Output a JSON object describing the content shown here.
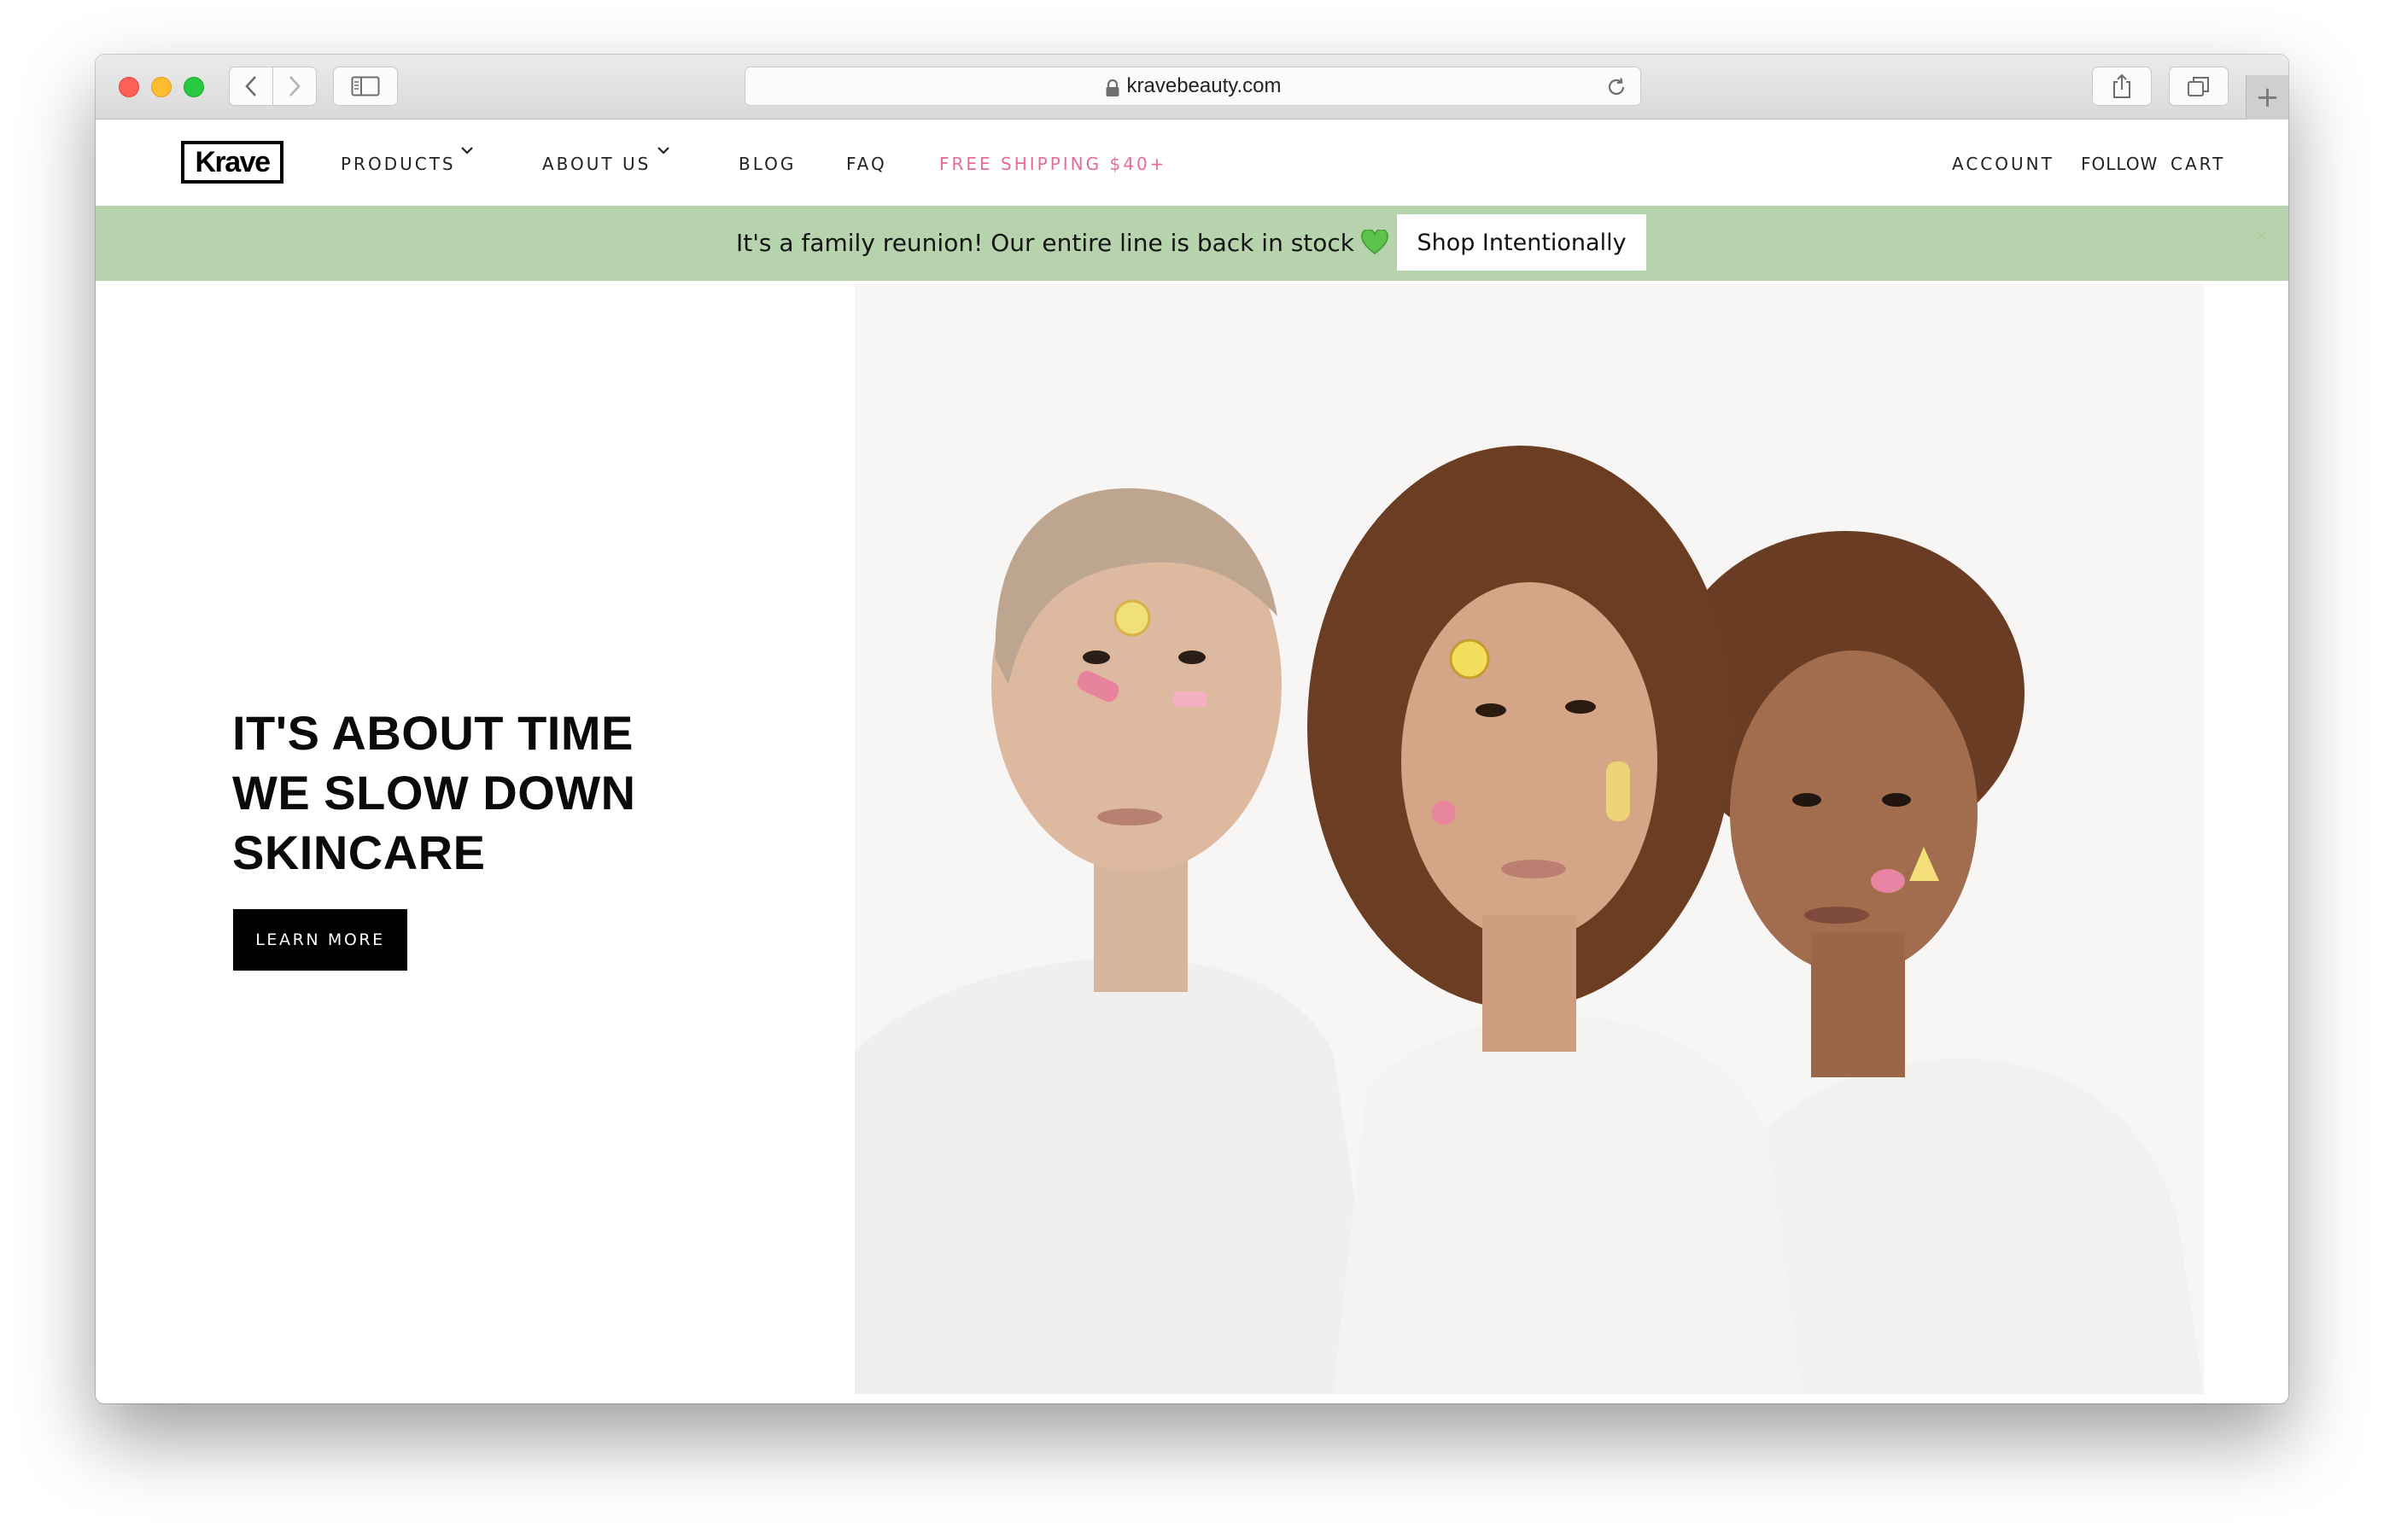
{
  "browser": {
    "url": "kravebeauty.com",
    "icons": [
      "back-icon",
      "forward-icon",
      "sidebar-icon",
      "lock-icon",
      "reload-icon",
      "share-icon",
      "tabs-icon",
      "new-tab-icon"
    ]
  },
  "header": {
    "logo": "Krave",
    "nav": {
      "products": "PRODUCTS",
      "about": "ABOUT US",
      "blog": "BLOG",
      "faq": "FAQ",
      "shipping": "FREE SHIPPING $40+",
      "account": "ACCOUNT",
      "follow": "FOLLOW",
      "cart": "CART"
    }
  },
  "promo": {
    "text": "It's a family reunion! Our entire line is back in stock",
    "button": "Shop Intentionally",
    "close": "×"
  },
  "hero": {
    "title": "IT'S ABOUT TIME\nWE SLOW DOWN\nSKINCARE",
    "button": "LEARN MORE"
  },
  "colors": {
    "promo_bg": "#b6d3ad",
    "shipping_pink": "#e86c90",
    "hero_button_bg": "#000000"
  }
}
